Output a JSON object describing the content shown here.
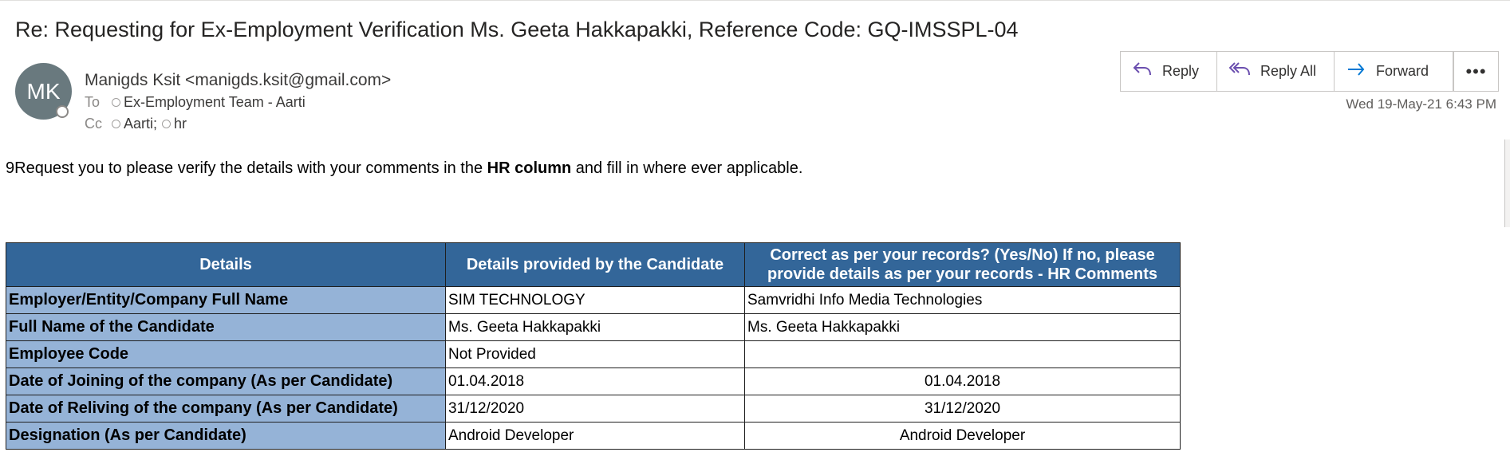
{
  "email": {
    "subject": "Re: Requesting for Ex-Employment Verification Ms. Geeta Hakkapakki, Reference Code: GQ-IMSSPL-04",
    "avatar_initials": "MK",
    "sender": "Manigds Ksit <manigds.ksit@gmail.com>",
    "to_label": "To",
    "to_value": "Ex-Employment Team - Aarti",
    "cc_label": "Cc",
    "cc_value_1": "Aarti;",
    "cc_value_2": "hr",
    "date": "Wed 19-May-21 6:43 PM"
  },
  "actions": {
    "reply": "Reply",
    "reply_all": "Reply All",
    "forward": "Forward",
    "more": "•••"
  },
  "body": {
    "prefix": "9Request you to please verify the details with your comments in the ",
    "bold": "HR column",
    "suffix": " and fill in where ever applicable."
  },
  "table": {
    "headers": [
      "Details",
      "Details provided by the Candidate",
      "Correct as per your records? (Yes/No) If no, please provide details as per your records - HR Comments"
    ],
    "rows": [
      {
        "label": "Employer/Entity/Company Full Name",
        "candidate": "SIM TECHNOLOGY",
        "hr": "Samvridhi Info Media Technologies"
      },
      {
        "label": "Full Name of the Candidate",
        "candidate": "Ms. Geeta Hakkapakki",
        "hr": "Ms. Geeta Hakkapakki"
      },
      {
        "label": "Employee Code",
        "candidate": "Not Provided",
        "hr": ""
      },
      {
        "label": "Date of Joining of the company (As per Candidate)",
        "candidate": "01.04.2018",
        "hr": "01.04.2018"
      },
      {
        "label": "Date of Reliving of the company (As per Candidate)",
        "candidate": "31/12/2020",
        "hr": "31/12/2020"
      },
      {
        "label": "Designation (As per Candidate)",
        "candidate": "Android Developer",
        "hr": "Android Developer"
      }
    ]
  },
  "colors": {
    "header_bg": "#336699",
    "label_bg": "#95b3d7",
    "avatar_bg": "#69797e",
    "accent": "#0078d4"
  }
}
